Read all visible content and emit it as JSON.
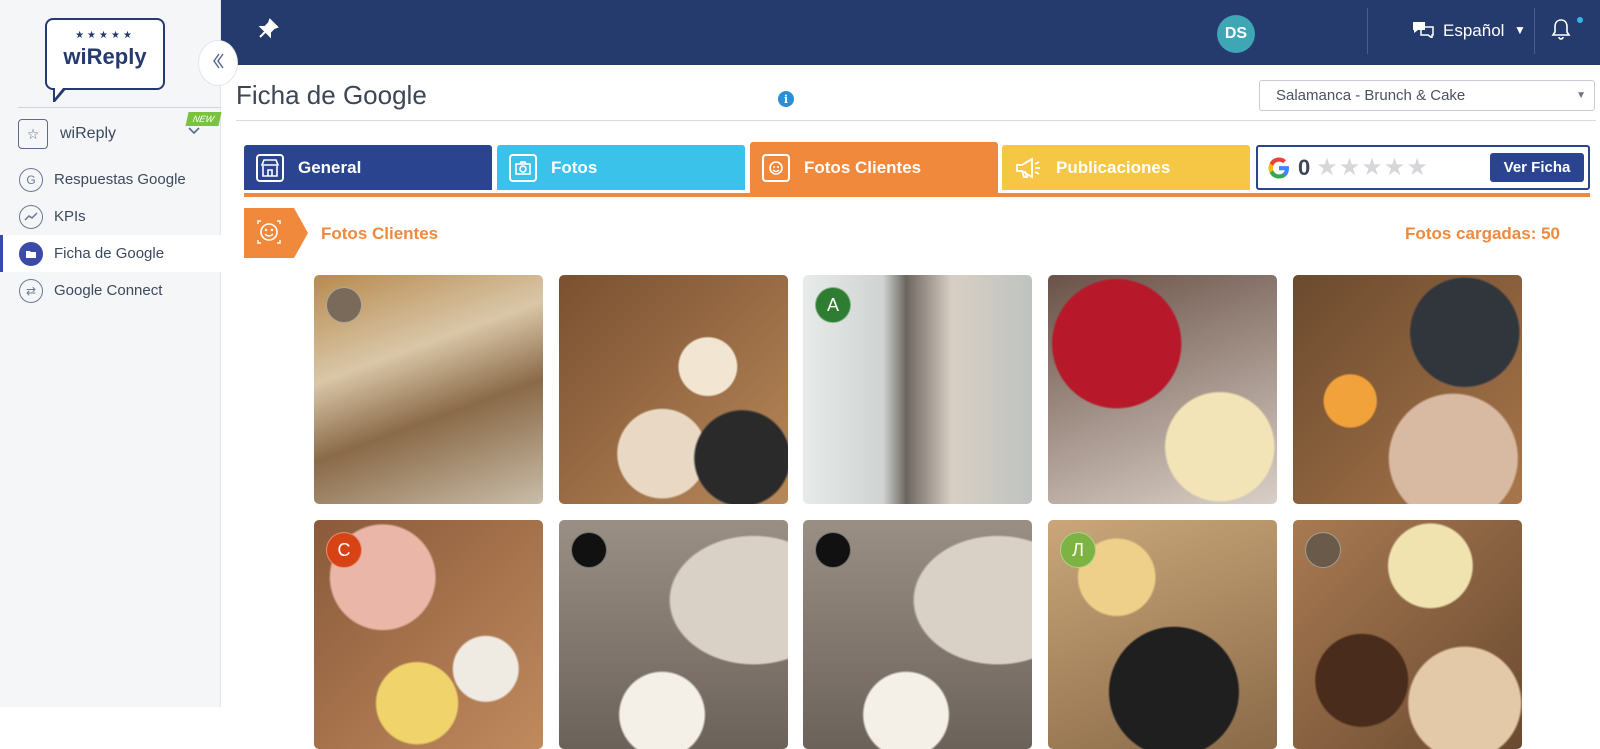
{
  "app": {
    "logo_stars": "★★★★★",
    "logo_text": "wiReply",
    "colors": {
      "navy": "#253b6e",
      "orange": "#f0893c",
      "cyan": "#3ac2ea",
      "yellow": "#f5c744",
      "blue": "#2b4490"
    }
  },
  "sidebar": {
    "app_switcher": {
      "label": "wiReply",
      "badge": "NEW",
      "icon": "star-icon"
    },
    "items": [
      {
        "label": "Respuestas Google",
        "icon": "google-circle-icon",
        "active": false
      },
      {
        "label": "KPIs",
        "icon": "trend-icon",
        "active": false
      },
      {
        "label": "Ficha de Google",
        "icon": "folder-icon",
        "active": true
      },
      {
        "label": "Google Connect",
        "icon": "sync-arrows-icon",
        "active": false
      }
    ]
  },
  "topbar": {
    "avatar_initials": "DS",
    "language": "Español"
  },
  "page": {
    "title": "Ficha de Google",
    "location_select": "Salamanca - Brunch & Cake"
  },
  "tabs": [
    {
      "label": "General",
      "icon": "storefront-icon"
    },
    {
      "label": "Fotos",
      "icon": "camera-icon"
    },
    {
      "label": "Fotos Clientes",
      "icon": "smiley-icon"
    },
    {
      "label": "Publicaciones",
      "icon": "megaphone-icon"
    }
  ],
  "google_card": {
    "rating_count": "0",
    "stars_filled": 0,
    "stars_total": 5,
    "button_label": "Ver Ficha"
  },
  "section": {
    "title": "Fotos Clientes",
    "count_label": "Fotos cargadas: 50"
  },
  "photos": [
    {
      "subject": "cafe interior with round table",
      "avatar_type": "photo",
      "avatar_letter": "",
      "avatar_color": "#7a6a5a"
    },
    {
      "subject": "brunch spread top view",
      "avatar_type": "none",
      "avatar_letter": "",
      "avatar_color": ""
    },
    {
      "subject": "Brunch & Cake storefront",
      "avatar_type": "letter",
      "avatar_letter": "A",
      "avatar_color": "#2e7d32"
    },
    {
      "subject": "cheesecake and cupcakes",
      "avatar_type": "none",
      "avatar_letter": "",
      "avatar_color": ""
    },
    {
      "subject": "brunch dishes with orange juice",
      "avatar_type": "none",
      "avatar_letter": "",
      "avatar_color": ""
    },
    {
      "subject": "cake slice and eggs benedict",
      "avatar_type": "letter",
      "avatar_letter": "C",
      "avatar_color": "#d84315"
    },
    {
      "subject": "latte in cafe interior",
      "avatar_type": "dark",
      "avatar_letter": "",
      "avatar_color": "#111111"
    },
    {
      "subject": "latte in cafe interior",
      "avatar_type": "dark",
      "avatar_letter": "",
      "avatar_color": "#111111"
    },
    {
      "subject": "eggs benedict plates",
      "avatar_type": "letter",
      "avatar_letter": "Л",
      "avatar_color": "#7cb342"
    },
    {
      "subject": "brunch plates overhead",
      "avatar_type": "photo",
      "avatar_letter": "",
      "avatar_color": "#6a5a4a"
    }
  ]
}
